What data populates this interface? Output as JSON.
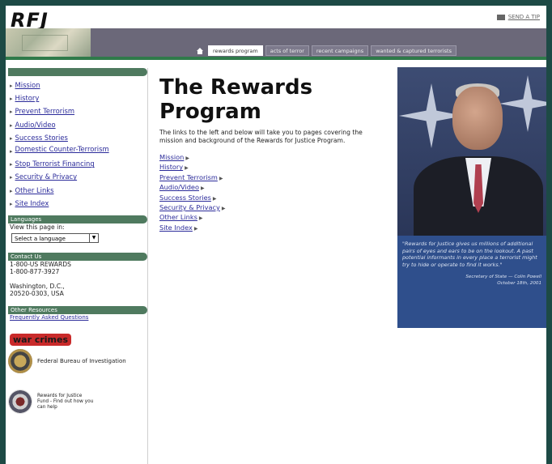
{
  "header": {
    "logo": "RFJ",
    "right_link": "SEND A TIP"
  },
  "nav": {
    "tabs": [
      {
        "label": "rewards program",
        "active": true
      },
      {
        "label": "acts of terror",
        "active": false
      },
      {
        "label": "recent campaigns",
        "active": false
      },
      {
        "label": "wanted & captured terrorists",
        "active": false
      }
    ],
    "home_icon": "home-icon"
  },
  "sidebar": {
    "links": [
      "Mission",
      "History",
      "Prevent Terrorism",
      "Audio/Video",
      "Success Stories",
      "Domestic Counter-Terrorism",
      "Stop Terrorist Financing",
      "Security & Privacy",
      "Other Links",
      "Site Index"
    ],
    "languages": {
      "heading": "Languages",
      "label": "View this page in:",
      "select_value": "Select a language"
    },
    "contact": {
      "heading": "Contact Us",
      "phone1": "1-800-US REWARDS",
      "phone2": "1-800-877-3927",
      "city": "Washington, D.C.,",
      "zip": "20520-0303, USA"
    },
    "resources": {
      "heading": "Other Resources",
      "faq": "Frequently Asked Questions"
    },
    "war_crimes": "war crimes",
    "fbi": "Federal Bureau of Investigation",
    "rfj_fund": "Rewards for Justice Fund - Find out how you can help"
  },
  "main": {
    "title_line1": "The Rewards",
    "title_line2": "Program",
    "intro": "The links to the left and below will take you to pages covering the mission and background of the Rewards for Justice Program.",
    "links": [
      "Mission",
      "History",
      "Prevent Terrorism",
      "Audio/Video",
      "Success Stories",
      "Security & Privacy",
      "Other Links",
      "Site Index"
    ]
  },
  "quote": {
    "text": "\"Rewards for Justice gives us millions of additional pairs of eyes and ears to be on the lookout. A past potential informants in every place a terrorist might try to hide or operate to find it works.\"",
    "attribution": "Secretary of State — Colin Powell",
    "date": "October 18th, 2001"
  }
}
